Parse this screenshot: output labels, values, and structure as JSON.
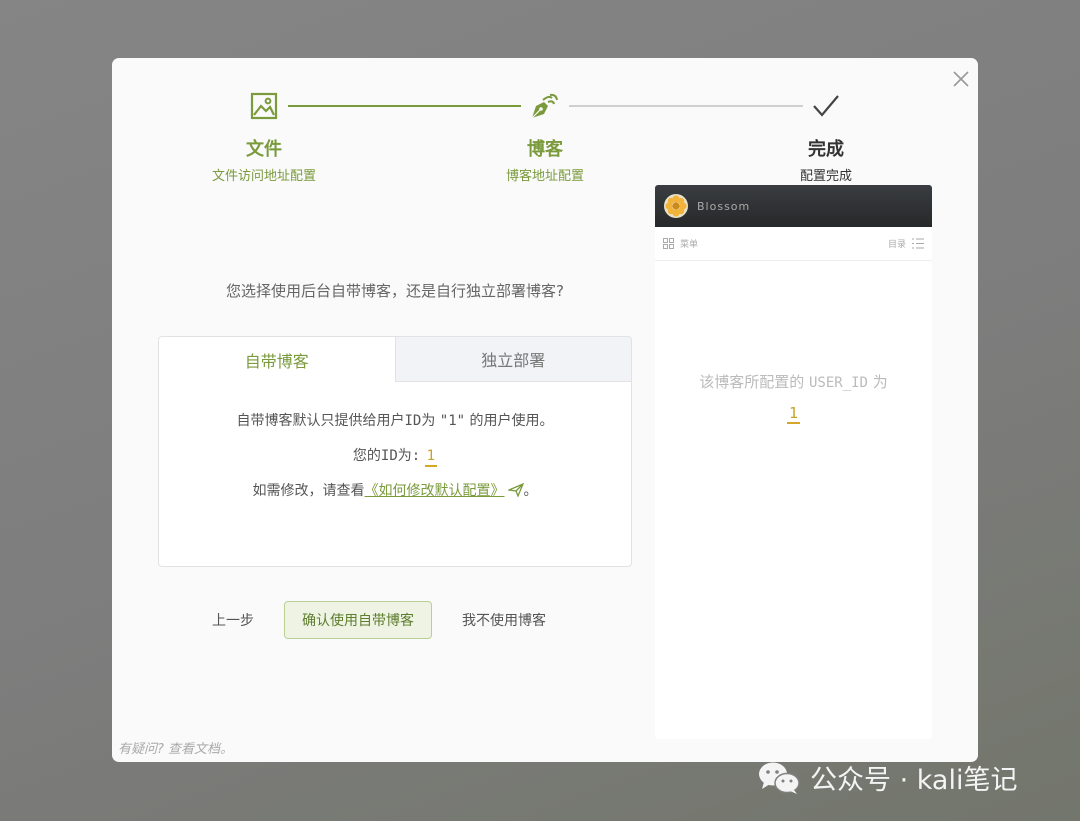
{
  "steps": [
    {
      "title": "文件",
      "subtitle": "文件访问地址配置",
      "icon": "image-icon"
    },
    {
      "title": "博客",
      "subtitle": "博客地址配置",
      "icon": "pen-nib-icon"
    },
    {
      "title": "完成",
      "subtitle": "配置完成",
      "icon": "checkmark-icon"
    }
  ],
  "question": "您选择使用后台自带博客，还是自行独立部署博客?",
  "tabs": [
    {
      "label": "自带博客",
      "active": true
    },
    {
      "label": "独立部署",
      "active": false
    }
  ],
  "panel": {
    "line1_pre": "自带博客默认只提供给用户",
    "line1_id": "ID",
    "line1_mid": "为 ",
    "line1_quote": "\"1\"",
    "line1_post": " 的用户使用。",
    "line2_label": "您的ID为:",
    "user_id": "1",
    "line3_pre": "如需修改，请查看",
    "doc_link": "《如何修改默认配置》",
    "line3_post": "。"
  },
  "actions": {
    "prev": "上一步",
    "confirm": "确认使用自带博客",
    "decline": "我不使用博客"
  },
  "help_text": "有疑问? 查看文档。",
  "preview": {
    "brand": "Blossom",
    "menu_label": "菜单",
    "toc_label": "目录",
    "message_pre": "该博客所配置的 ",
    "message_code": "USER_ID",
    "message_post": " 为",
    "user_id": "1"
  },
  "watermark": "公众号 · kali笔记",
  "colors": {
    "accent": "#7a9a3c",
    "highlight": "#d6a62a"
  }
}
